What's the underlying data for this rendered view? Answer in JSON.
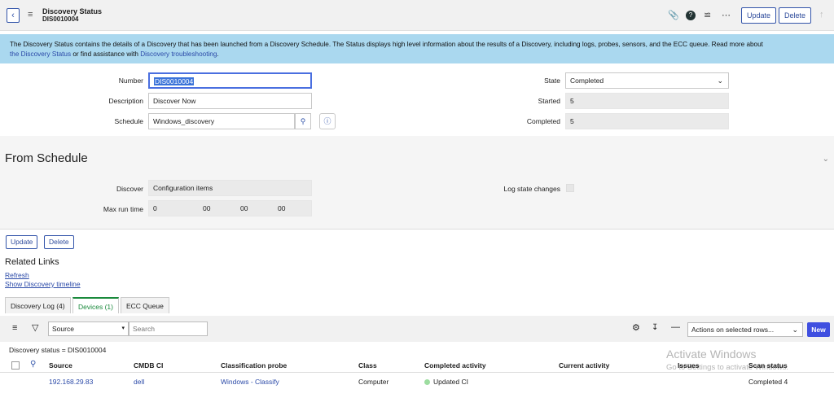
{
  "header": {
    "title": "Discovery Status",
    "record": "DIS0010004",
    "update_label": "Update",
    "delete_label": "Delete"
  },
  "info": {
    "text1": "The Discovery Status contains the details of a Discovery that has been launched from a Discovery Schedule. The Status displays high level information about the results of a Discovery, including logs, probes, sensors, and the ECC queue. Read more about",
    "link1": "the Discovery Status",
    "text2": " or find assistance with ",
    "link2": "Discovery troubleshooting",
    "text3": "."
  },
  "form": {
    "number_label": "Number",
    "number_value": "DIS0010004",
    "description_label": "Description",
    "description_value": "Discover Now",
    "schedule_label": "Schedule",
    "schedule_value": "Windows_discovery",
    "state_label": "State",
    "state_value": "Completed",
    "started_label": "Started",
    "started_value": "5",
    "completed_label": "Completed",
    "completed_value": "5"
  },
  "from_schedule": {
    "title": "From Schedule",
    "discover_label": "Discover",
    "discover_value": "Configuration items",
    "maxrun_label": "Max run time",
    "maxrun_days": "0",
    "maxrun_h": "00",
    "maxrun_m": "00",
    "maxrun_s": "00",
    "log_state_label": "Log state changes"
  },
  "actions": {
    "update": "Update",
    "delete": "Delete"
  },
  "related": {
    "title": "Related Links",
    "refresh": "Refresh",
    "timeline": "Show Discovery timeline"
  },
  "tabs": [
    {
      "label": "Discovery Log (4)"
    },
    {
      "label": "Devices (1)"
    },
    {
      "label": "ECC Queue"
    }
  ],
  "list": {
    "filter_field": "Source",
    "search_placeholder": "Search",
    "actions_select": "Actions on selected rows...",
    "new_label": "New",
    "breadcrumb": "Discovery status = DIS0010004",
    "columns": [
      "Source",
      "CMDB CI",
      "Classification probe",
      "Class",
      "Completed activity",
      "Current activity",
      "Issues",
      "Scan status"
    ],
    "rows": [
      {
        "source": "192.168.29.83",
        "cmdb_ci": "dell",
        "probe": "Windows - Classify",
        "class": "Computer",
        "completed_activity": "Updated CI",
        "current_activity": "",
        "issues": "",
        "scan_status": "Completed 4"
      }
    ]
  },
  "watermark": {
    "line1": "Activate Windows",
    "line2": "Go to Settings to activate Windows."
  },
  "colors": {
    "info_bg": "#aad8ef",
    "accent": "#3355aa",
    "active_tab": "#1a8a3c",
    "new_button": "#3f4fe0"
  }
}
